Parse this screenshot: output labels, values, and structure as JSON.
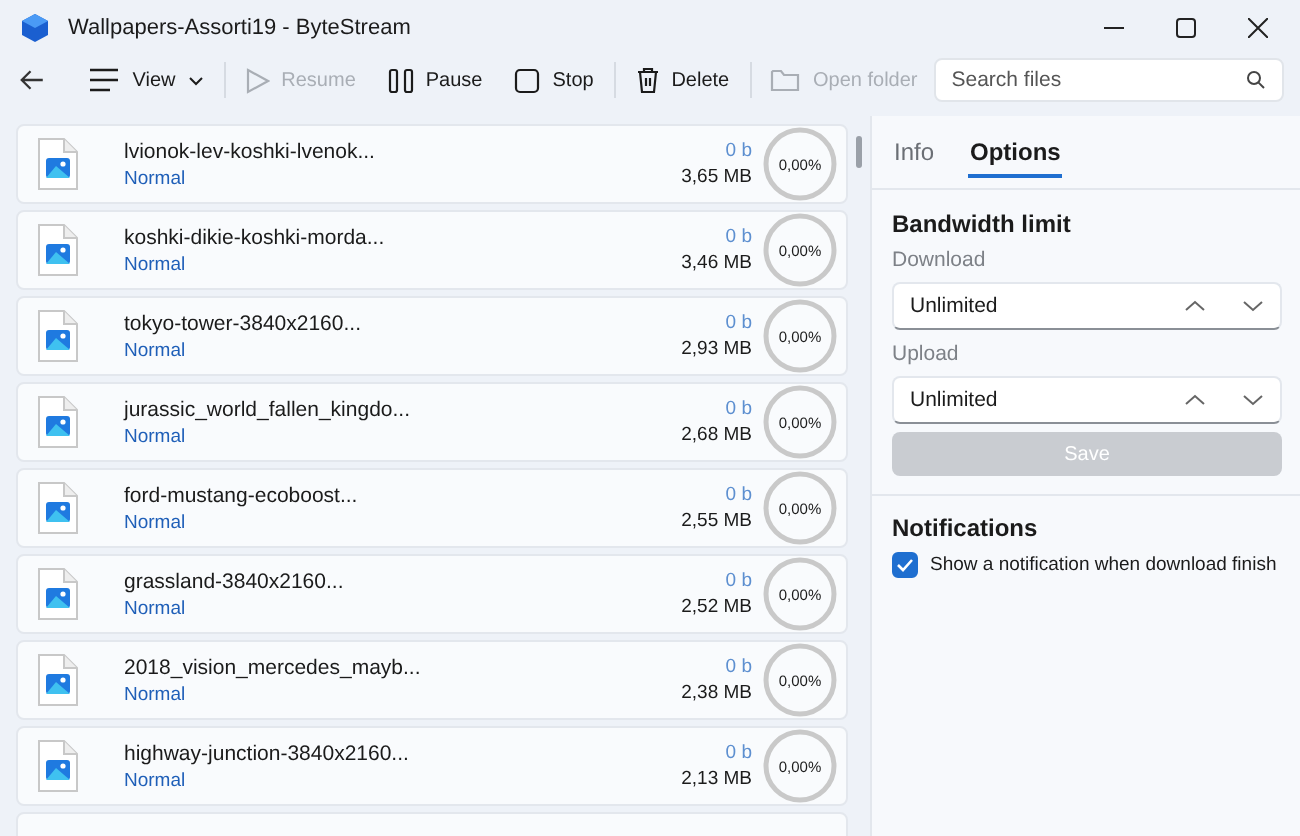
{
  "window": {
    "title": "Wallpapers-Assorti19 - ByteStream"
  },
  "toolbar": {
    "buttons": [
      {
        "kind": "view",
        "label": "View",
        "disabled": false
      },
      {
        "kind": "resume",
        "label": "Resume",
        "disabled": true
      },
      {
        "kind": "pause",
        "label": "Pause",
        "disabled": false
      },
      {
        "kind": "stop",
        "label": "Stop",
        "disabled": false
      },
      {
        "kind": "delete",
        "label": "Delete",
        "disabled": false
      },
      {
        "kind": "folder",
        "label": "Open folder",
        "disabled": true
      }
    ],
    "search": {
      "placeholder": "Search files"
    }
  },
  "downloads": [
    {
      "name": "lvionok-lev-koshki-lvenok...",
      "priority": "Normal",
      "downloaded": "0 b",
      "size": "3,65 MB",
      "progress": "0,00%"
    },
    {
      "name": "koshki-dikie-koshki-morda...",
      "priority": "Normal",
      "downloaded": "0 b",
      "size": "3,46 MB",
      "progress": "0,00%"
    },
    {
      "name": "tokyo-tower-3840x2160...",
      "priority": "Normal",
      "downloaded": "0 b",
      "size": "2,93 MB",
      "progress": "0,00%"
    },
    {
      "name": "jurassic_world_fallen_kingdo...",
      "priority": "Normal",
      "downloaded": "0 b",
      "size": "2,68 MB",
      "progress": "0,00%"
    },
    {
      "name": "ford-mustang-ecoboost...",
      "priority": "Normal",
      "downloaded": "0 b",
      "size": "2,55 MB",
      "progress": "0,00%"
    },
    {
      "name": "grassland-3840x2160...",
      "priority": "Normal",
      "downloaded": "0 b",
      "size": "2,52 MB",
      "progress": "0,00%"
    },
    {
      "name": "2018_vision_mercedes_mayb...",
      "priority": "Normal",
      "downloaded": "0 b",
      "size": "2,38 MB",
      "progress": "0,00%"
    },
    {
      "name": "highway-junction-3840x2160...",
      "priority": "Normal",
      "downloaded": "0 b",
      "size": "2,13 MB",
      "progress": "0,00%"
    }
  ],
  "tabs": [
    {
      "label": "Info",
      "selected": false
    },
    {
      "label": "Options",
      "selected": true
    }
  ],
  "bandwidth": {
    "title": "Bandwidth limit",
    "fields": [
      {
        "label": "Download",
        "value": "Unlimited"
      },
      {
        "label": "Upload",
        "value": "Unlimited"
      }
    ],
    "save": {
      "label": "Save",
      "disabled": true
    }
  },
  "notifications": {
    "title": "Notifications",
    "option": {
      "label": "Show a notification when download finish",
      "checked": true
    }
  }
}
